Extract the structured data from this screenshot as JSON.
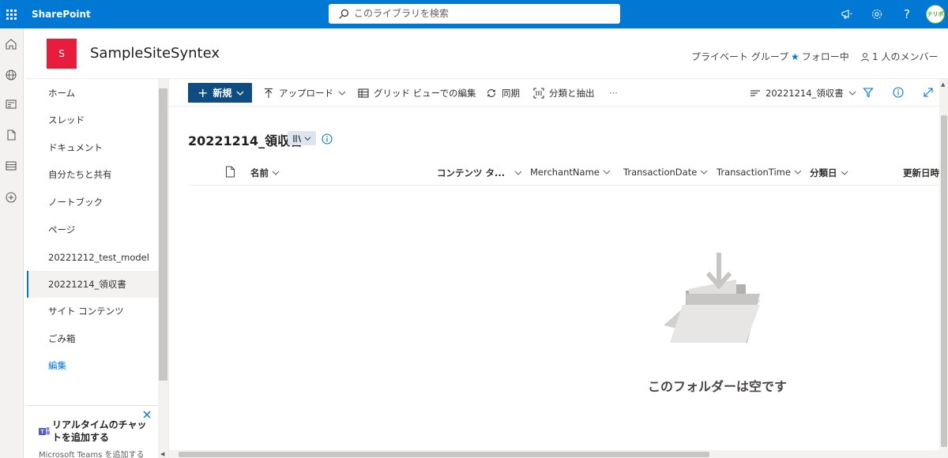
{
  "suite": {
    "brand": "SharePoint",
    "search_placeholder": "このライブラリを検索",
    "avatar_text": "テリポ"
  },
  "site": {
    "logo_letter": "S",
    "title": "SampleSiteSyntex",
    "privacy": "プライベート グループ",
    "follow": "フォロー中",
    "members": "1 人のメンバー"
  },
  "nav": {
    "items": [
      {
        "label": "ホーム"
      },
      {
        "label": "スレッド"
      },
      {
        "label": "ドキュメント"
      },
      {
        "label": "自分たちと共有"
      },
      {
        "label": "ノートブック"
      },
      {
        "label": "ページ"
      },
      {
        "label": "20221212_test_model"
      },
      {
        "label": "20221214_領収書"
      },
      {
        "label": "サイト コンテンツ"
      },
      {
        "label": "ごみ箱"
      }
    ],
    "edit": "編集",
    "selected_index": 7
  },
  "teams_promo": {
    "title": "リアルタイムのチャットを追加する",
    "subtitle": "Microsoft Teams を追加する"
  },
  "commandbar": {
    "new": "新規",
    "upload": "アップロード",
    "grid_edit": "グリッド ビューでの編集",
    "sync": "同期",
    "classify": "分類と抽出",
    "more": "···",
    "view_name": "20221214_領収書"
  },
  "library": {
    "title": "20221214_領収書",
    "columns": [
      "名前",
      "コンテンツ タ...",
      "MerchantName",
      "TransactionDate",
      "TransactionTime",
      "分類日",
      "更新日時"
    ]
  },
  "empty_state": {
    "message": "このフォルダーは空です"
  },
  "colors": {
    "suite_blue": "#0078d4",
    "new_button": "#0f4c81",
    "site_logo": "#e81c3d"
  }
}
